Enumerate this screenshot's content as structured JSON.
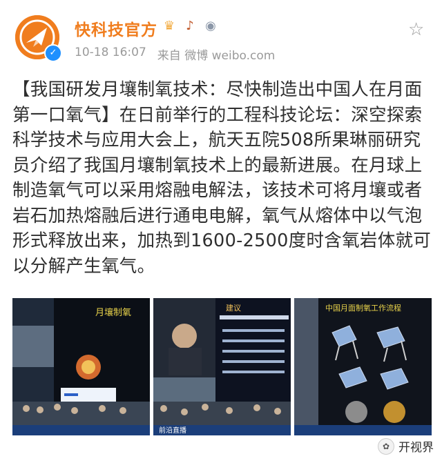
{
  "header": {
    "username": "快科技官方",
    "timestamp": "10-18 16:07",
    "source_prefix": "来自",
    "source": "微博 weibo.com",
    "badges": [
      "crown-icon",
      "guitar-icon",
      "medal-icon"
    ]
  },
  "post": {
    "text": "【我国研发月壤制氧技术：尽快制造出中国人在月面第一口氧气】在日前举行的工程科技论坛：深空探索科学技术与应用大会上，航天五院508所果琳丽研究员介绍了我国月壤制氧技术上的最新进展。在月球上制造氧气可以采用熔融电解法，该技术可将月壤或者岩石加热熔融后进行通电电解，氧气从熔体中以气泡形式释放出来，加热到1600-2500度时含氧岩体就可以分解产生氧气。"
  },
  "images": [
    {
      "slide_title": "月壤制氧"
    },
    {
      "slide_title": "建议",
      "caption": "前沿直播"
    },
    {
      "slide_title": "中国月面制氧工作流程"
    }
  ],
  "watermark": {
    "text": "开视界"
  },
  "colors": {
    "accent": "#f07d1e",
    "text": "#2f2f2f",
    "muted": "#9a9a9a",
    "verified": "#1e90ff"
  }
}
